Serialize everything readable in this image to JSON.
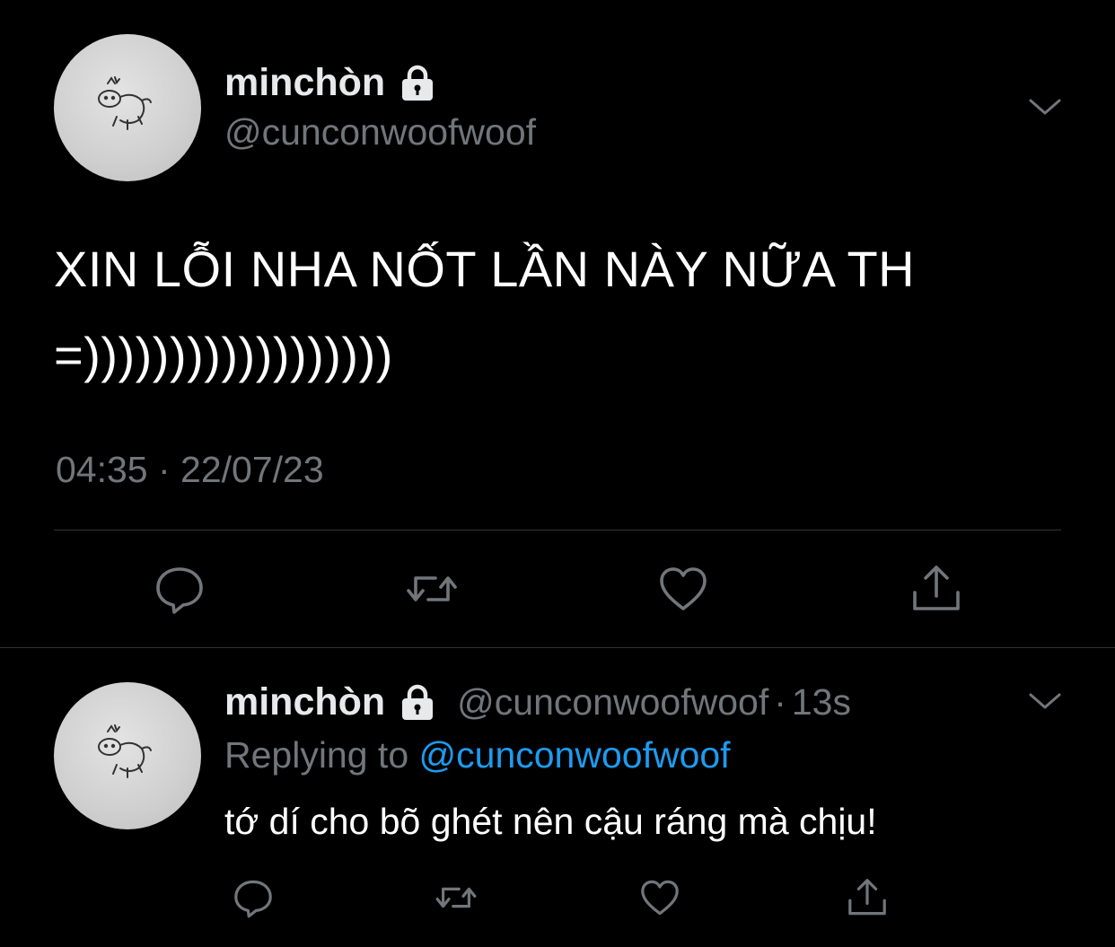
{
  "main_tweet": {
    "display_name": "minchòn",
    "handle": "@cunconwoofwoof",
    "text_line1": "XIN LỖI NHA NỐT LẦN NÀY NỮA TH",
    "text_line2": "=))))))))))))))))))",
    "timestamp": "04:35 · 22/07/23",
    "protected_icon": "lock-icon",
    "menu_icon": "chevron-down-icon",
    "actions": [
      {
        "name": "reply",
        "icon": "comment-icon"
      },
      {
        "name": "retweet",
        "icon": "retweet-icon"
      },
      {
        "name": "like",
        "icon": "heart-icon"
      },
      {
        "name": "share",
        "icon": "share-icon"
      }
    ]
  },
  "reply_tweet": {
    "display_name": "minchòn",
    "handle": "@cunconwoofwoof",
    "separator": "·",
    "age": "13s",
    "replying_label": "Replying to",
    "replying_to": "@cunconwoofwoof",
    "text": "tớ dí cho bõ ghét nên cậu ráng mà chịu!",
    "protected_icon": "lock-icon",
    "menu_icon": "chevron-down-icon"
  },
  "colors": {
    "background": "#000000",
    "primary_text": "#e7e9ea",
    "secondary_text": "#71767b",
    "link": "#1d9bf0",
    "divider": "#2f3336"
  }
}
